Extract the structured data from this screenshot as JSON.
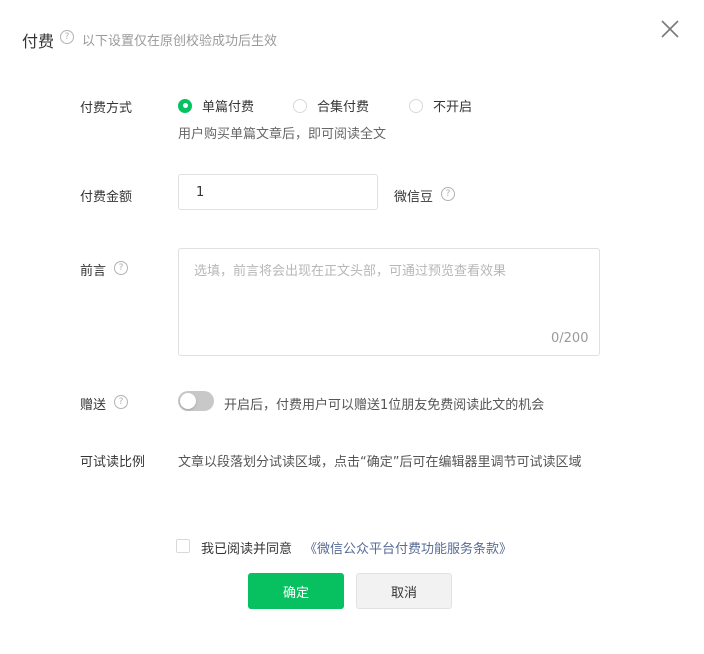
{
  "header": {
    "title": "付费",
    "subtitle": "以下设置仅在原创校验成功后生效"
  },
  "payment_method": {
    "label": "付费方式",
    "options": [
      {
        "label": "单篇付费",
        "checked": true
      },
      {
        "label": "合集付费",
        "checked": false
      },
      {
        "label": "不开启",
        "checked": false
      }
    ],
    "description": "用户购买单篇文章后，即可阅读全文"
  },
  "amount": {
    "label": "付费金额",
    "value": "1",
    "unit": "微信豆"
  },
  "preface": {
    "label": "前言",
    "placeholder": "选填，前言将会出现在正文头部，可通过预览查看效果",
    "value": "",
    "counter": "0/200"
  },
  "gift": {
    "label": "赠送",
    "enabled": false,
    "description": "开启后，付费用户可以赠送1位朋友免费阅读此文的机会"
  },
  "trial": {
    "label": "可试读比例",
    "description": "文章以段落划分试读区域，点击“确定”后可在编辑器里调节可试读区域"
  },
  "agreement": {
    "checked": false,
    "text": "我已阅读并同意",
    "link_text": "《微信公众平台付费功能服务条款》"
  },
  "buttons": {
    "confirm": "确定",
    "cancel": "取消"
  },
  "colors": {
    "accent": "#07c160",
    "link": "#576b95"
  }
}
